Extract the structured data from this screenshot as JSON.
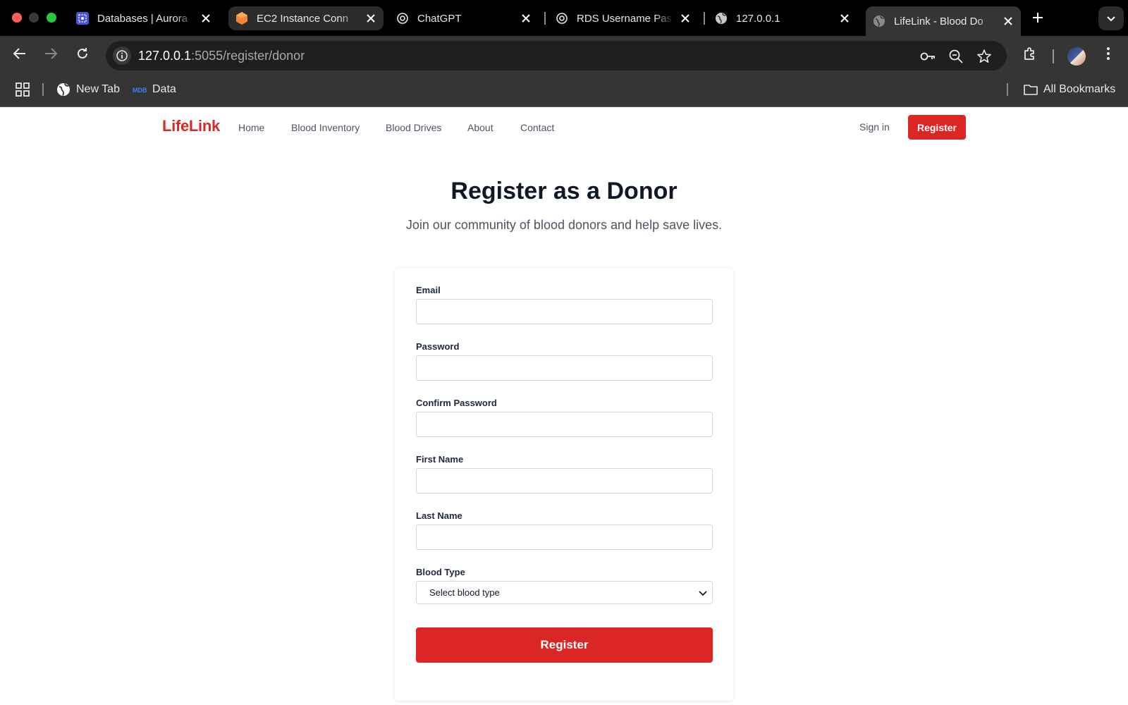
{
  "browser": {
    "tabs": [
      {
        "title": "Databases | Aurora",
        "icon": "rds-databases-icon"
      },
      {
        "title": "EC2 Instance Conn",
        "icon": "aws-ec2-icon"
      },
      {
        "title": "ChatGPT",
        "icon": "openai-icon"
      },
      {
        "title": "RDS Username Pas",
        "icon": "openai-icon"
      },
      {
        "title": "127.0.0.1",
        "icon": "globe-icon"
      },
      {
        "title": "LifeLink - Blood Do",
        "icon": "globe-icon",
        "active": true
      }
    ],
    "address": {
      "host": "127.0.0.1",
      "path": ":5055/register/donor"
    },
    "bookmarks": [
      {
        "label": "New Tab",
        "icon": "globe-icon"
      },
      {
        "label": "Data",
        "icon": "mdb-icon"
      }
    ],
    "all_bookmarks_label": "All Bookmarks"
  },
  "site": {
    "brand": "LifeLink",
    "nav": [
      "Home",
      "Blood Inventory",
      "Blood Drives",
      "About",
      "Contact"
    ],
    "sign_in": "Sign in",
    "register": "Register",
    "accent_color": "#dc2626"
  },
  "form": {
    "title": "Register as a Donor",
    "subtitle": "Join our community of blood donors and help save lives.",
    "fields": {
      "email": {
        "label": "Email",
        "value": ""
      },
      "password": {
        "label": "Password",
        "value": ""
      },
      "confirm_password": {
        "label": "Confirm Password",
        "value": ""
      },
      "first_name": {
        "label": "First Name",
        "value": ""
      },
      "last_name": {
        "label": "Last Name",
        "value": ""
      },
      "blood_type": {
        "label": "Blood Type",
        "selected": "Select blood type"
      }
    },
    "submit_label": "Register"
  }
}
